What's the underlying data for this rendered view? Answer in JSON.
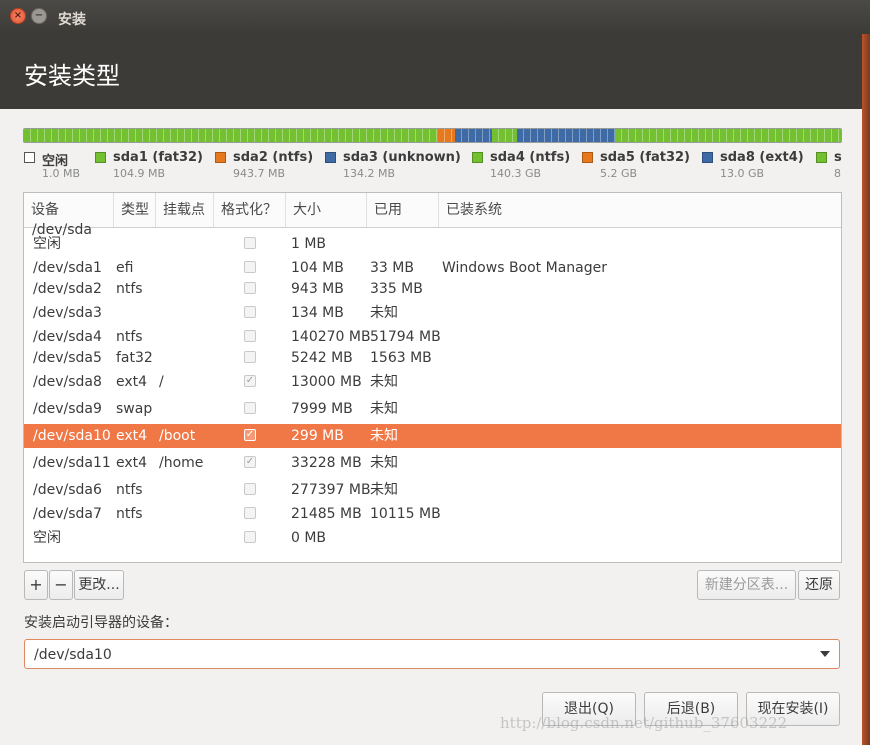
{
  "window": {
    "title": "安装",
    "close_icon": "×",
    "minimize_icon": "−"
  },
  "page": {
    "title": "安装类型"
  },
  "partition_bar": {
    "segments": [
      {
        "color": "#73c131",
        "fraction": 0.507
      },
      {
        "color": "#e6781e",
        "fraction": 0.02
      },
      {
        "color": "#3e6aa6",
        "fraction": 0.046
      },
      {
        "color": "#73c131",
        "fraction": 0.03
      },
      {
        "color": "#3e6aa6",
        "fraction": 0.12
      },
      {
        "color": "#73c131",
        "fraction": 0.277
      }
    ]
  },
  "legend": [
    {
      "name": "空闲",
      "size": "1.0 MB",
      "color": "#ffffff"
    },
    {
      "name": "sda1 (fat32)",
      "size": "104.9 MB",
      "color": "#73c131"
    },
    {
      "name": "sda2 (ntfs)",
      "size": "943.7 MB",
      "color": "#e6781e"
    },
    {
      "name": "sda3 (unknown)",
      "size": "134.2 MB",
      "color": "#3e6aa6"
    },
    {
      "name": "sda4 (ntfs)",
      "size": "140.3 GB",
      "color": "#73c131"
    },
    {
      "name": "sda5 (fat32)",
      "size": "5.2 GB",
      "color": "#e6781e"
    },
    {
      "name": "sda8 (ext4)",
      "size": "13.0 GB",
      "color": "#3e6aa6"
    },
    {
      "name": "s",
      "size": "8",
      "color": "#73c131"
    }
  ],
  "table": {
    "headers": [
      "设备",
      "类型",
      "挂载点",
      "格式化？",
      "大小",
      "已用",
      "已装系统"
    ],
    "disk_label": "/dev/sda",
    "rows": [
      {
        "device": "空闲",
        "type": "",
        "mount": "",
        "format": false,
        "size": "1 MB",
        "used": "",
        "os": ""
      },
      {
        "device": "/dev/sda1",
        "type": "efi",
        "mount": "",
        "format": false,
        "size": "104 MB",
        "used": "33 MB",
        "os": "Windows Boot Manager"
      },
      {
        "device": "/dev/sda2",
        "type": "ntfs",
        "mount": "",
        "format": false,
        "size": "943 MB",
        "used": "335 MB",
        "os": ""
      },
      {
        "device": "/dev/sda3",
        "type": "",
        "mount": "",
        "format": false,
        "size": "134 MB",
        "used": "未知",
        "os": ""
      },
      {
        "device": "/dev/sda4",
        "type": "ntfs",
        "mount": "",
        "format": false,
        "size": "140270 MB",
        "used": "51794 MB",
        "os": ""
      },
      {
        "device": "/dev/sda5",
        "type": "fat32",
        "mount": "",
        "format": false,
        "size": "5242 MB",
        "used": "1563 MB",
        "os": ""
      },
      {
        "device": "/dev/sda8",
        "type": "ext4",
        "mount": "/",
        "format": true,
        "size": "13000 MB",
        "used": "未知",
        "os": ""
      },
      {
        "device": "/dev/sda9",
        "type": "swap",
        "mount": "",
        "format": false,
        "size": "7999 MB",
        "used": "未知",
        "os": ""
      },
      {
        "device": "/dev/sda10",
        "type": "ext4",
        "mount": "/boot",
        "format": true,
        "size": "299 MB",
        "used": "未知",
        "os": "",
        "selected": true
      },
      {
        "device": "/dev/sda11",
        "type": "ext4",
        "mount": "/home",
        "format": true,
        "size": "33228 MB",
        "used": "未知",
        "os": ""
      },
      {
        "device": "/dev/sda6",
        "type": "ntfs",
        "mount": "",
        "format": false,
        "size": "277397 MB",
        "used": "未知",
        "os": ""
      },
      {
        "device": "/dev/sda7",
        "type": "ntfs",
        "mount": "",
        "format": false,
        "size": "21485 MB",
        "used": "10115 MB",
        "os": ""
      },
      {
        "device": "空闲",
        "type": "",
        "mount": "",
        "format": false,
        "size": "0 MB",
        "used": "",
        "os": ""
      }
    ]
  },
  "toolbar": {
    "add_label": "+",
    "remove_label": "−",
    "change_label": "更改...",
    "new_table_label": "新建分区表...",
    "revert_label": "还原"
  },
  "bootloader": {
    "label": "安装启动引导器的设备：",
    "value": "/dev/sda10"
  },
  "footer": {
    "quit_label": "退出(Q)",
    "back_label": "后退(B)",
    "install_label": "现在安装(I)"
  },
  "watermark": "http://blog.csdn.net/github_37603222"
}
